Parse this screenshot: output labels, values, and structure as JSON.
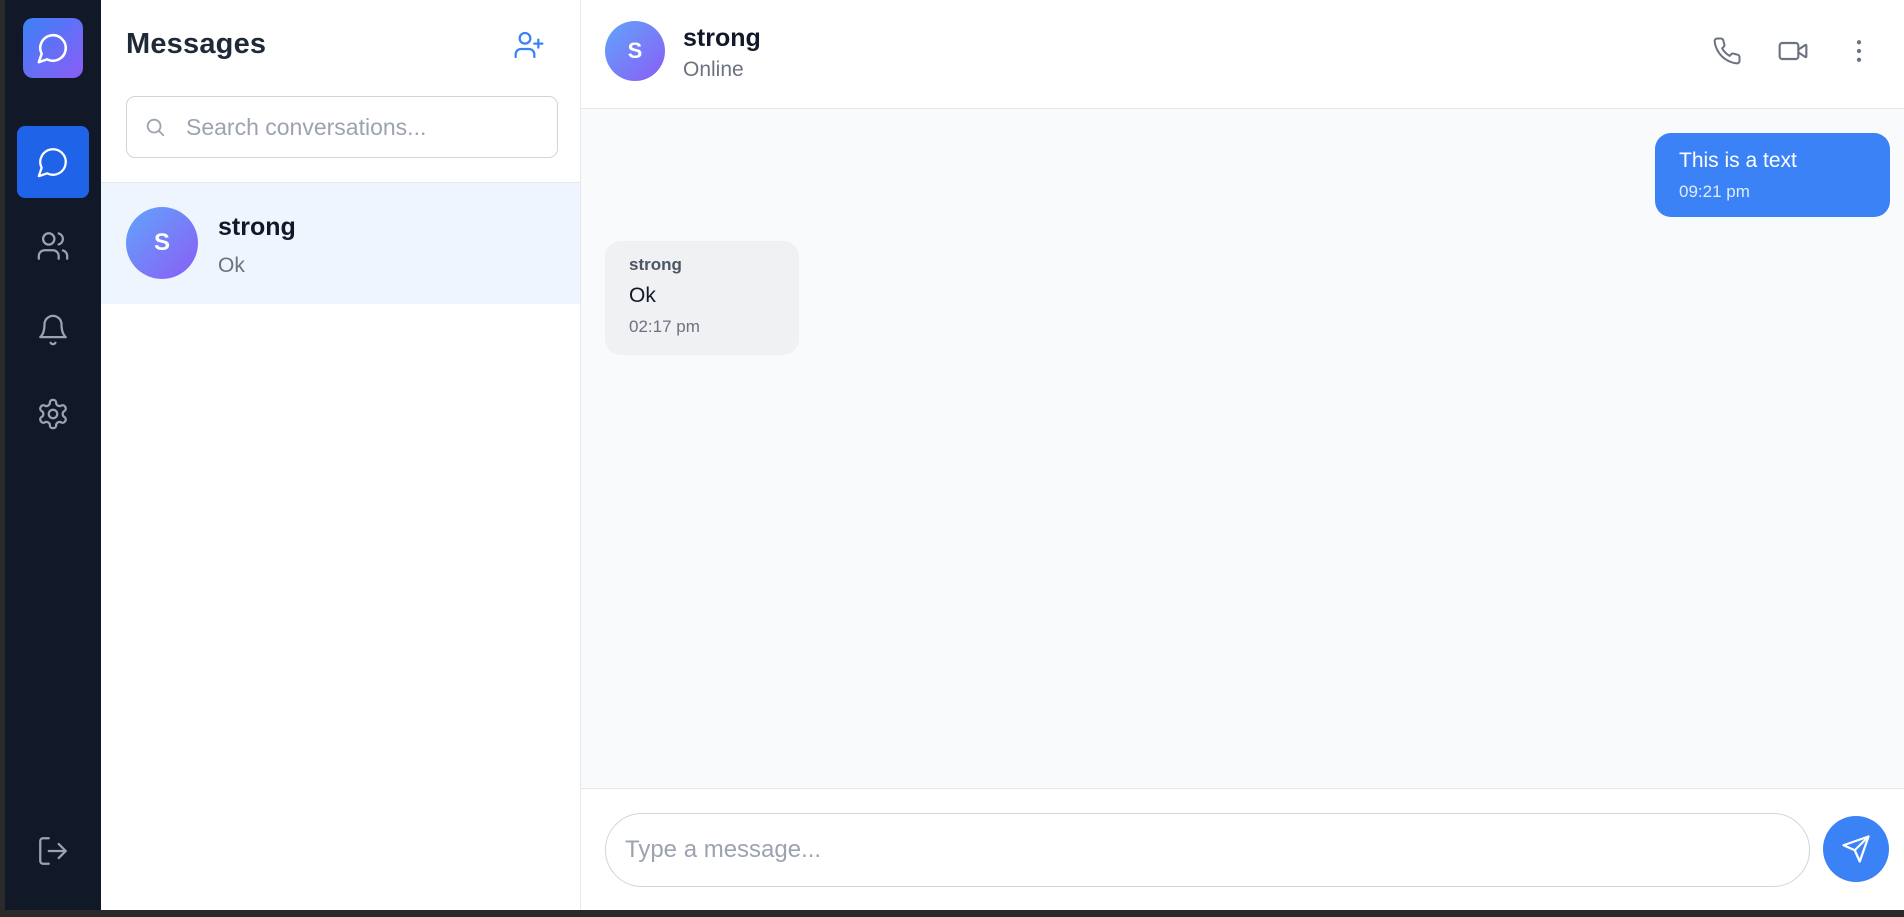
{
  "app": {
    "accent_color": "#3b82f6",
    "rail_color": "#111827"
  },
  "rail": {
    "logo_icon": "message-circle-icon",
    "items": [
      {
        "name": "chats",
        "icon": "message-circle-icon",
        "active": true
      },
      {
        "name": "contacts",
        "icon": "users-icon",
        "active": false
      },
      {
        "name": "notifications",
        "icon": "bell-icon",
        "active": false
      },
      {
        "name": "settings",
        "icon": "gear-icon",
        "active": false
      }
    ],
    "logout_icon": "log-out-icon"
  },
  "conversations": {
    "title": "Messages",
    "add_icon": "user-plus-icon",
    "search": {
      "placeholder": "Search conversations...",
      "value": ""
    },
    "items": [
      {
        "avatar_initial": "S",
        "name": "strong",
        "preview": "Ok",
        "selected": true
      }
    ]
  },
  "chat": {
    "header": {
      "avatar_initial": "S",
      "name": "strong",
      "status": "Online",
      "actions": [
        "phone-icon",
        "video-icon",
        "more-vertical-icon"
      ]
    },
    "messages": [
      {
        "direction": "outgoing",
        "text": "This is a text",
        "time": "09:21 pm"
      },
      {
        "direction": "incoming",
        "sender": "strong",
        "text": "Ok",
        "time": "02:17 pm"
      }
    ],
    "composer": {
      "placeholder": "Type a message...",
      "value": "",
      "send_icon": "send-icon"
    }
  }
}
